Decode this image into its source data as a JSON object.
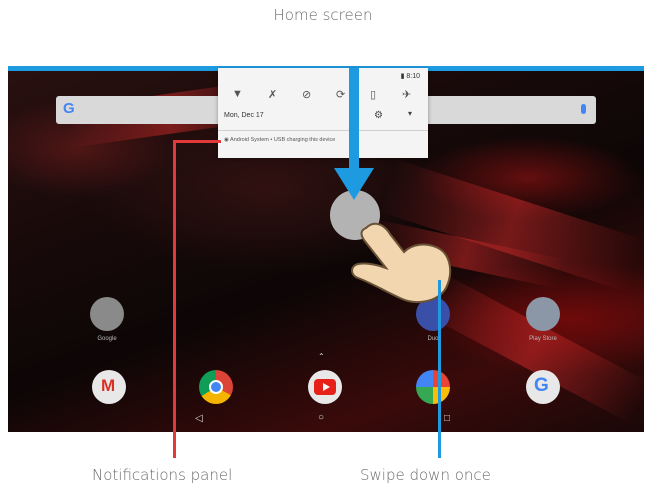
{
  "captions": {
    "top": "Home screen",
    "left": "Notifications panel",
    "right": "Swipe down once"
  },
  "notification_panel": {
    "time": "8:10",
    "date": "Mon, Dec 17",
    "notification_text": "Android System • USB charging this device",
    "quick_settings": [
      "wifi-icon",
      "bluetooth-icon",
      "dnd-icon",
      "rotate-icon",
      "flashlight-icon",
      "airplane-icon"
    ]
  },
  "search": {
    "logo_letter": "G"
  },
  "apps": [
    {
      "label": "Google",
      "color": "#8a8a8a"
    },
    {
      "label": "Duo",
      "color": "#3a4fa8"
    },
    {
      "label": "Play Store",
      "color": "#8b96a6"
    }
  ],
  "dock": [
    "gmail-icon",
    "chrome-icon",
    "youtube-icon",
    "photos-icon",
    "google-icon"
  ],
  "nav": [
    "back-icon",
    "home-icon",
    "recents-icon"
  ],
  "colors": {
    "accent_blue": "#1e9be0",
    "accent_red": "#e23a3a"
  }
}
